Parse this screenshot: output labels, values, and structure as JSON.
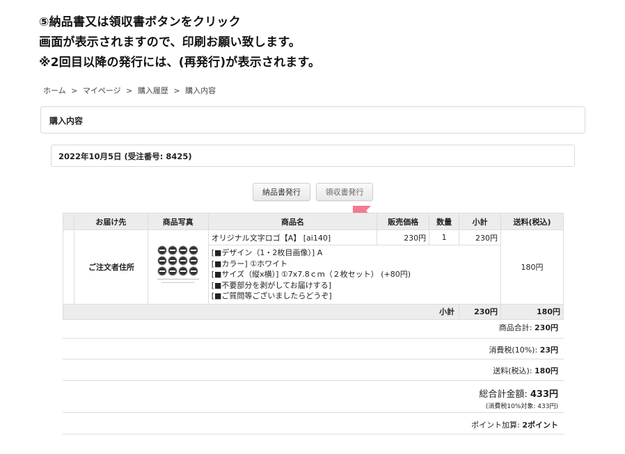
{
  "instructions": [
    "⑤納品書又は領収書ボタンをクリック",
    "画面が表示されますので、印刷お願い致します。",
    "※2回目以降の発行には、(再発行)が表示されます。"
  ],
  "breadcrumb": [
    "ホーム",
    ">",
    "マイページ",
    ">",
    "購入履歴",
    ">",
    "購入内容"
  ],
  "panel_title": "購入内容",
  "order_header": "2022年10月5日 (受注番号: 8425)",
  "buttons": {
    "delivery": "納品書発行",
    "receipt": "領収書発行"
  },
  "colors": {
    "arrow": "#f27b8c",
    "header_bg": "#ececec"
  },
  "table": {
    "headers": [
      "お届け先",
      "商品写真",
      "商品名",
      "販売価格",
      "数量",
      "小計",
      "送料(税込)"
    ],
    "address": "ご注文者住所",
    "product_name": "オリジナル文字ロゴ【A】 [ai140]",
    "price": "230円",
    "qty": "1",
    "line_subtotal": "230円",
    "options": [
      "[■デザイン（1・2枚目画像）] A",
      "[■カラー] ①ホワイト",
      "[■サイズ（縦x横）] ①7x7.8ｃｍ（２枚セット） (+80円)",
      "[■不要部分を剥がしてお届けする]",
      "[■ご質問等ございましたらどうぞ]"
    ],
    "shipping": "180円",
    "subtotal_label": "小計",
    "subtotal_value": "230円",
    "subtotal_shipping": "180円"
  },
  "summary": {
    "goods_label": "商品合計:",
    "goods_value": "230円",
    "tax_label": "消費税(10%):",
    "tax_value": "23円",
    "ship_label": "送料(税込):",
    "ship_value": "180円",
    "total_label": "総合計金額:",
    "total_value": "433円",
    "total_note": "(消費税10%対象: 433円)",
    "points_label": "ポイント加算:",
    "points_value": "2ポイント"
  }
}
